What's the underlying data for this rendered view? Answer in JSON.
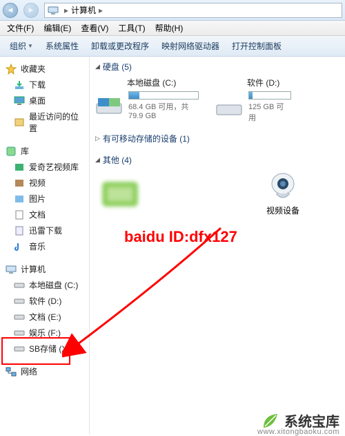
{
  "breadcrumb": {
    "root_icon": "计",
    "location": "计算机"
  },
  "menu": {
    "file": "文件(F)",
    "edit": "编辑(E)",
    "view": "查看(V)",
    "tools": "工具(T)",
    "help": "帮助(H)"
  },
  "toolbar": {
    "organize": "组织",
    "sysprops": "系统属性",
    "uninstall": "卸载或更改程序",
    "mapdrive": "映射网络驱动器",
    "controlpanel": "打开控制面板"
  },
  "sidebar": {
    "favorites": {
      "label": "收藏夹",
      "items": [
        "下载",
        "桌面",
        "最近访问的位置"
      ]
    },
    "libraries": {
      "label": "库",
      "items": [
        "爱奇艺视频库",
        "视频",
        "图片",
        "文档",
        "迅雷下载",
        "音乐"
      ]
    },
    "computer": {
      "label": "计算机",
      "items": [
        "本地磁盘 (C:)",
        "软件 (D:)",
        "文档 (E:)",
        "娱乐 (F:)",
        "SB存储 (X:)"
      ]
    },
    "network": {
      "label": "网络"
    }
  },
  "sections": {
    "hdd": {
      "title": "硬盘 (5)",
      "drives": [
        {
          "name": "本地磁盘 (C:)",
          "caption": "68.4 GB 可用，共 79.9 GB",
          "fill_pct": 15
        },
        {
          "name": "软件 (D:)",
          "caption": "125 GB 可用",
          "fill_pct": 8
        }
      ]
    },
    "removable": {
      "title": "有可移动存储的设备 (1)"
    },
    "other": {
      "title": "其他 (4)",
      "video_device": "视频设备"
    }
  },
  "watermark": "baidu ID:dfx127",
  "footer": {
    "brand": "系统宝库",
    "url": "www.xitongbaoku.com"
  }
}
